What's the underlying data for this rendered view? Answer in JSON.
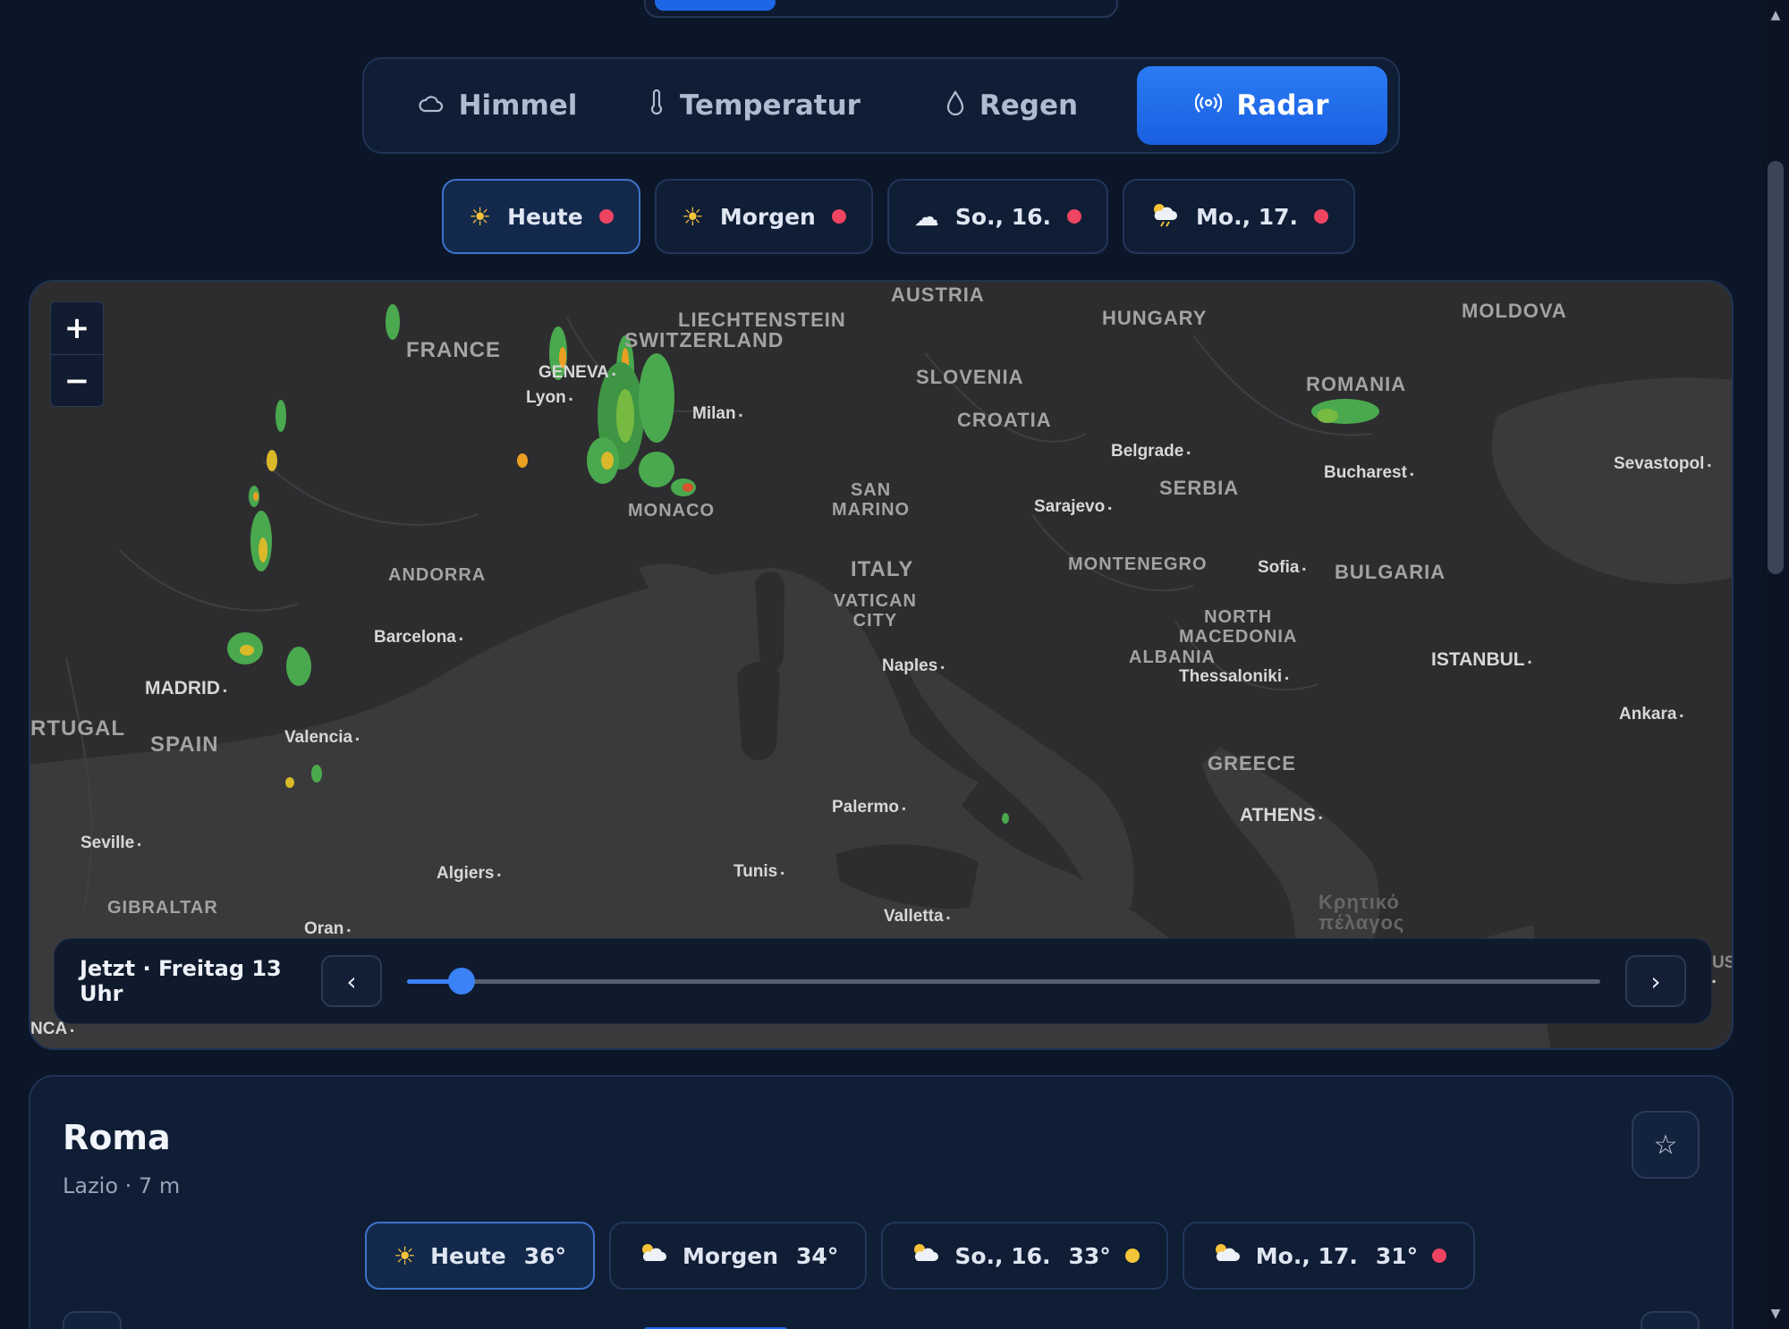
{
  "view_tabs": [
    {
      "label": "Himmel",
      "icon": "cloud-outline-icon"
    },
    {
      "label": "Temperatur",
      "icon": "thermometer-icon"
    },
    {
      "label": "Regen",
      "icon": "droplet-icon"
    },
    {
      "label": "Radar",
      "icon": "radar-icon",
      "active": true
    }
  ],
  "day_chips": [
    {
      "label": "Heute",
      "icon": "sun-icon",
      "alert": "red",
      "active": true
    },
    {
      "label": "Morgen",
      "icon": "sun-icon",
      "alert": "red"
    },
    {
      "label": "So., 16.",
      "icon": "cloud-icon",
      "alert": "red"
    },
    {
      "label": "Mo., 17.",
      "icon": "sun-cloud-rain-icon",
      "alert": "red"
    }
  ],
  "map": {
    "zoom_in": "+",
    "zoom_out": "−",
    "countries": {
      "france": "FRANCE",
      "liechtenstein": "LIECHTENSTEIN",
      "switzerland": "SWITZERLAND",
      "austria": "AUSTRIA",
      "hungary": "HUNGARY",
      "moldova": "MOLDOVA",
      "slovenia": "SLOVENIA",
      "croatia": "CROATIA",
      "romania": "ROMANIA",
      "serbia": "SERBIA",
      "monaco": "MONACO",
      "san_marino": "SAN\nMARINO",
      "andorra": "ANDORRA",
      "italy": "ITALY",
      "vatican": "VATICAN\nCITY",
      "montenegro": "MONTENEGRO",
      "bulgaria": "BULGARIA",
      "north_macedonia": "NORTH\nMACEDONIA",
      "albania": "ALBANIA",
      "spain": "SPAIN",
      "portugal": "RTUGAL",
      "greece": "GREECE",
      "gibraltar": "GIBRALTAR",
      "crete_sea": "Κρητικό\nπέλαγος"
    },
    "cities": {
      "geneva": "GENEVA",
      "lyon": "Lyon",
      "milan": "Milan",
      "belgrade": "Belgrade",
      "bucharest": "Bucharest",
      "sevastopol": "Sevastopol",
      "sarajevo": "Sarajevo",
      "sofia": "Sofia",
      "barcelona": "Barcelona",
      "madrid": "MADRID",
      "naples": "Naples",
      "thessaloniki": "Thessaloniki",
      "istanbul": "ISTANBUL",
      "valencia": "Valencia",
      "ankara": "Ankara",
      "palermo": "Palermo",
      "athens": "ATHENS",
      "seville": "Seville",
      "algiers": "Algiers",
      "tunis": "Tunis",
      "oran": "Oran",
      "valletta": "Valletta",
      "nca": "NCA",
      "us": "US"
    },
    "time_label": "Jetzt · Freitag 13 Uhr",
    "prev": "‹",
    "next": "›",
    "slider_position": 0.046
  },
  "location": {
    "name": "Roma",
    "subtitle": "Lazio · 7 m",
    "favorite_icon": "star-outline-icon",
    "days": [
      {
        "label": "Heute",
        "temp": "36°",
        "icon": "sun-icon",
        "active": true
      },
      {
        "label": "Morgen",
        "temp": "34°",
        "icon": "sun-cloud-icon"
      },
      {
        "label": "So., 16.",
        "temp": "33°",
        "icon": "sun-cloud-icon",
        "alert": "yellow"
      },
      {
        "label": "Mo., 17.",
        "temp": "31°",
        "icon": "sun-cloud-icon",
        "alert": "red"
      }
    ]
  },
  "colors": {
    "accent": "#1d66e6",
    "background": "#0b1629",
    "alert_red": "#ef4461",
    "alert_yellow": "#f2c53a"
  }
}
